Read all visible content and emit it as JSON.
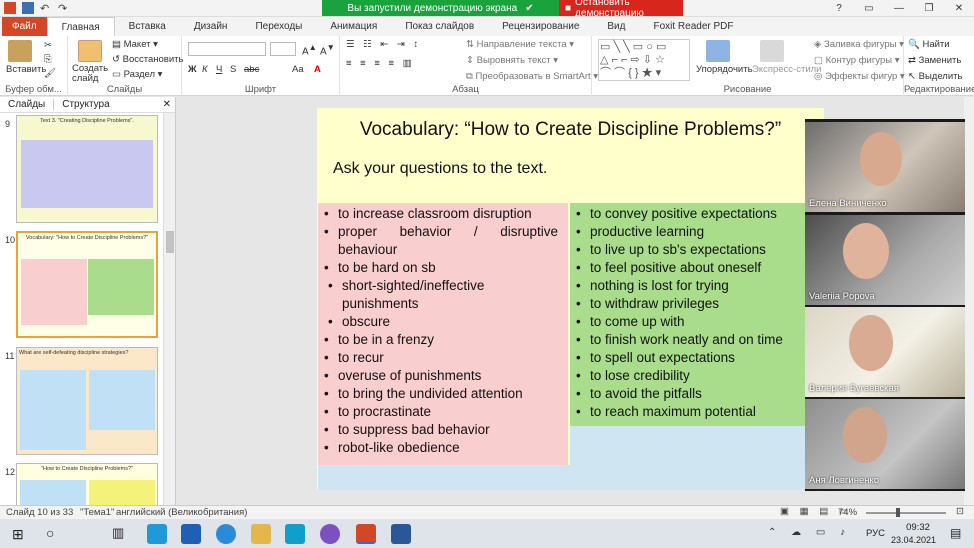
{
  "titlebar": {
    "demo_msg": "Вы запустили демонстрацию экрана",
    "stop_demo": "Остановить демонстрацию"
  },
  "tabs": [
    "Файл",
    "Главная",
    "Вставка",
    "Дизайн",
    "Переходы",
    "Анимация",
    "Показ слайдов",
    "Рецензирование",
    "Вид",
    "Foxit Reader PDF"
  ],
  "ribbon": {
    "clipboard": {
      "paste": "Вставить",
      "label": "Буфер обм..."
    },
    "slides": {
      "create": "Создать слайд",
      "layout": "Макет",
      "reset": "Восстановить",
      "section": "Раздел",
      "label": "Слайды"
    },
    "font": {
      "label": "Шрифт",
      "bold": "Ж",
      "italic": "К",
      "underline": "Ч",
      "strike": "S",
      "abc": "abc",
      "aa": "Aa"
    },
    "paragraph": {
      "direction": "Направление текста",
      "align": "Выровнять текст",
      "smartart": "Преобразовать в SmartArt",
      "label": "Абзац"
    },
    "drawing": {
      "arrange": "Упорядочить",
      "styles": "Экспресс-стили",
      "fill": "Заливка фигуры",
      "outline": "Контур фигуры",
      "effects": "Эффекты фигур",
      "label": "Рисование"
    },
    "editing": {
      "find": "Найти",
      "replace": "Заменить",
      "select": "Выделить",
      "label": "Редактирование"
    }
  },
  "panel": {
    "tab_slides": "Слайды",
    "tab_structure": "Структура",
    "thumbs": [
      {
        "num": "9",
        "title": "Text 3. \"Creating Discipline Problems\"."
      },
      {
        "num": "10",
        "title": "Vocabulary: \"How to Create Discipline Problems?\""
      },
      {
        "num": "11",
        "title": "What are self-defeating discipline strategies?"
      },
      {
        "num": "12",
        "title": "\"How to Create Discipline Problems?\""
      }
    ]
  },
  "slide": {
    "title": "Vocabulary: “How to Create Discipline Problems?”",
    "subtitle": "Ask your questions to the text.",
    "left_items": [
      "to increase classroom disruption",
      "proper behavior / disruptive behaviour",
      "to be hard on sb",
      "short-sighted/ineffective punishments",
      "obscure",
      "to be in a frenzy",
      "to recur",
      "overuse of punishments",
      "to bring the undivided attention",
      "to procrastinate",
      "to suppress bad behavior",
      "robot-like obedience"
    ],
    "right_items": [
      "to convey positive expectations",
      "productive learning",
      "to live up to sb's expectations",
      "to feel positive about oneself",
      "nothing is lost for trying",
      "to withdraw privileges",
      "to come up with",
      "to finish work neatly and on time",
      "to spell out expectations",
      "to lose credibility",
      "to avoid the pitfalls",
      "to reach maximum potential"
    ]
  },
  "video": {
    "participants": [
      "Елена Виниченко",
      "Valeriia Popova",
      "Валерия Бугаевская",
      "Аня Ловгиненко"
    ]
  },
  "status": {
    "slide": "Слайд 10 из 33",
    "theme": "\"Тема1\"",
    "lang": "английский (Великобритания)",
    "zoom": "74%"
  },
  "taskbar": {
    "lang": "РУС",
    "time": "09:32",
    "date": "23.04.2021"
  },
  "colors": {
    "accent": "#d24726",
    "demo_green": "#1aa33c",
    "demo_red": "#d9261c",
    "slide_bg": "#ffffcc",
    "left_col": "#f9cece",
    "right_col": "#a9dd8c"
  }
}
